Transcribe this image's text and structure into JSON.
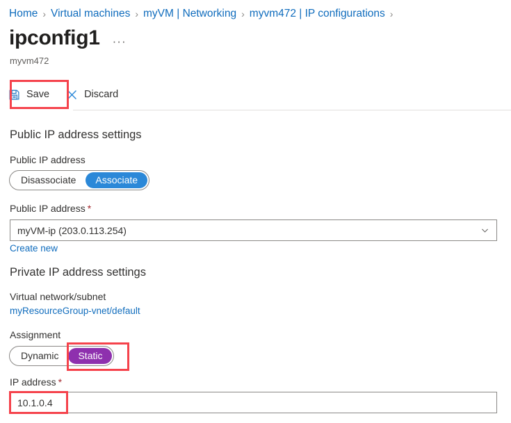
{
  "breadcrumb": {
    "items": [
      {
        "label": "Home"
      },
      {
        "label": "Virtual machines"
      },
      {
        "label": "myVM | Networking"
      },
      {
        "label": "myvm472 | IP configurations"
      }
    ],
    "separator": "›"
  },
  "header": {
    "title": "ipconfig1",
    "more_label": "···",
    "subtitle": "myvm472"
  },
  "toolbar": {
    "save_label": "Save",
    "discard_label": "Discard",
    "save_icon": "save-floppy-icon",
    "discard_icon": "close-x-icon"
  },
  "public_ip": {
    "section_heading": "Public IP address settings",
    "toggle_label": "Public IP address",
    "toggle_options": [
      "Disassociate",
      "Associate"
    ],
    "toggle_selected": "Associate",
    "field_label": "Public IP address",
    "required_marker": "*",
    "selected_value": "myVM-ip (203.0.113.254)",
    "create_new_label": "Create new"
  },
  "private_ip": {
    "section_heading": "Private IP address settings",
    "vnet_label": "Virtual network/subnet",
    "vnet_value": "myResourceGroup-vnet/default",
    "assignment_label": "Assignment",
    "assignment_options": [
      "Dynamic",
      "Static"
    ],
    "assignment_selected": "Static",
    "ip_label": "IP address",
    "required_marker": "*",
    "ip_value": "10.1.0.4"
  },
  "colors": {
    "link": "#0f6cbd",
    "accent_blue": "#2b88d8",
    "accent_purple": "#8e30ae",
    "highlight_red": "#f5424b",
    "required_red": "#a4262c"
  }
}
